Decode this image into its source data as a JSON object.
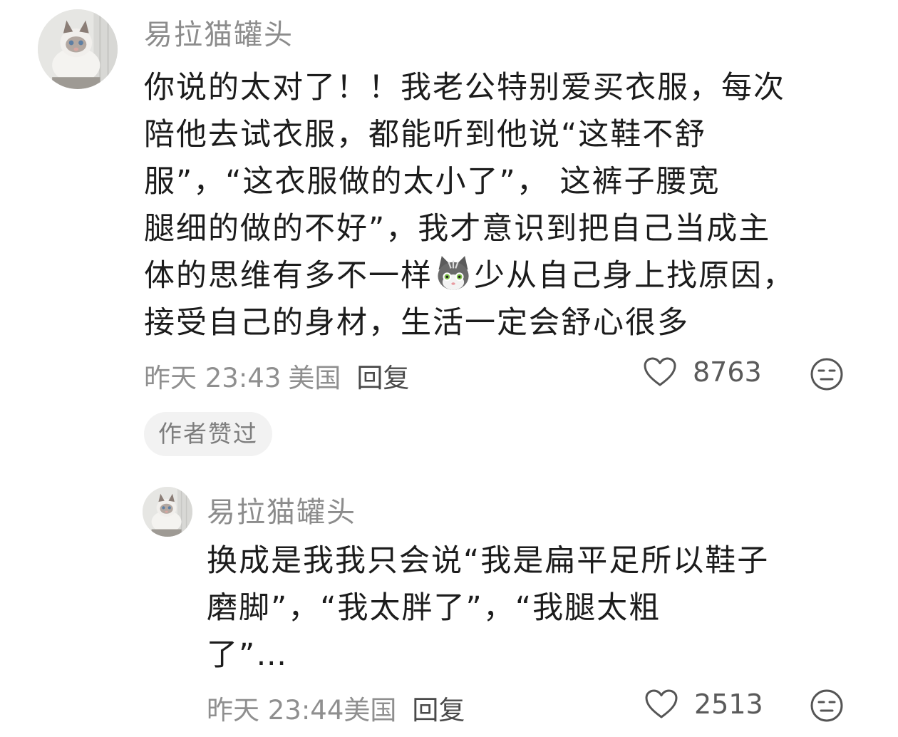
{
  "comment1": {
    "username": "易拉猫罐头",
    "lines": [
      "你说的太对了！！我老公特别爱买衣服，每次",
      "陪他去试衣服，都能听到他说“这鞋不舒",
      "服”，“这衣服做的太小了”，  这裤子腰宽",
      "腿细的做的不好”，我才意识到把自己当成主",
      "体的思维有多不一样",
      "少从自己身上找原因，",
      "接受自己的身材，生活一定会舒心很多"
    ],
    "time": "昨天 23:43",
    "location": "美国",
    "reply_label": "回复",
    "likes": "8763",
    "badge": "作者赞过"
  },
  "comment2": {
    "username": "易拉猫罐头",
    "lines": [
      "换成是我我只会说“我是扁平足所以鞋子",
      "磨脚”，“我太胖了”，“我腿太粗",
      "了”…"
    ],
    "time": "昨天 23:44",
    "location": "美国",
    "reply_label": "回复",
    "likes": "2513"
  },
  "icons": {
    "like": "heart-outline-icon",
    "dislike": "neutral-face-icon",
    "inline_emoji": "cat-face-emoji"
  },
  "colors": {
    "username": "#8c8c8c",
    "meta": "#8f8f8f",
    "badge_bg": "#f2f2f2"
  }
}
